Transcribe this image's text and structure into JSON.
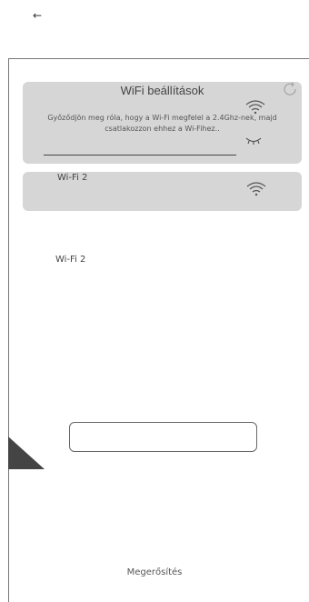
{
  "header": {
    "back_icon": "←"
  },
  "wifi_settings": {
    "title": "WiFi beállítások",
    "description": "Győződjön meg róla, hogy a Wi-Fi megfelel a 2.4Ghz-nek, majd csatlakozzon ehhez a Wi-Fihez.."
  },
  "networks": [
    {
      "name": "Wi-Fi 2"
    }
  ],
  "selected_label": "Wi-Fi 2",
  "footer": {
    "confirm_label": "Megerősítés"
  }
}
